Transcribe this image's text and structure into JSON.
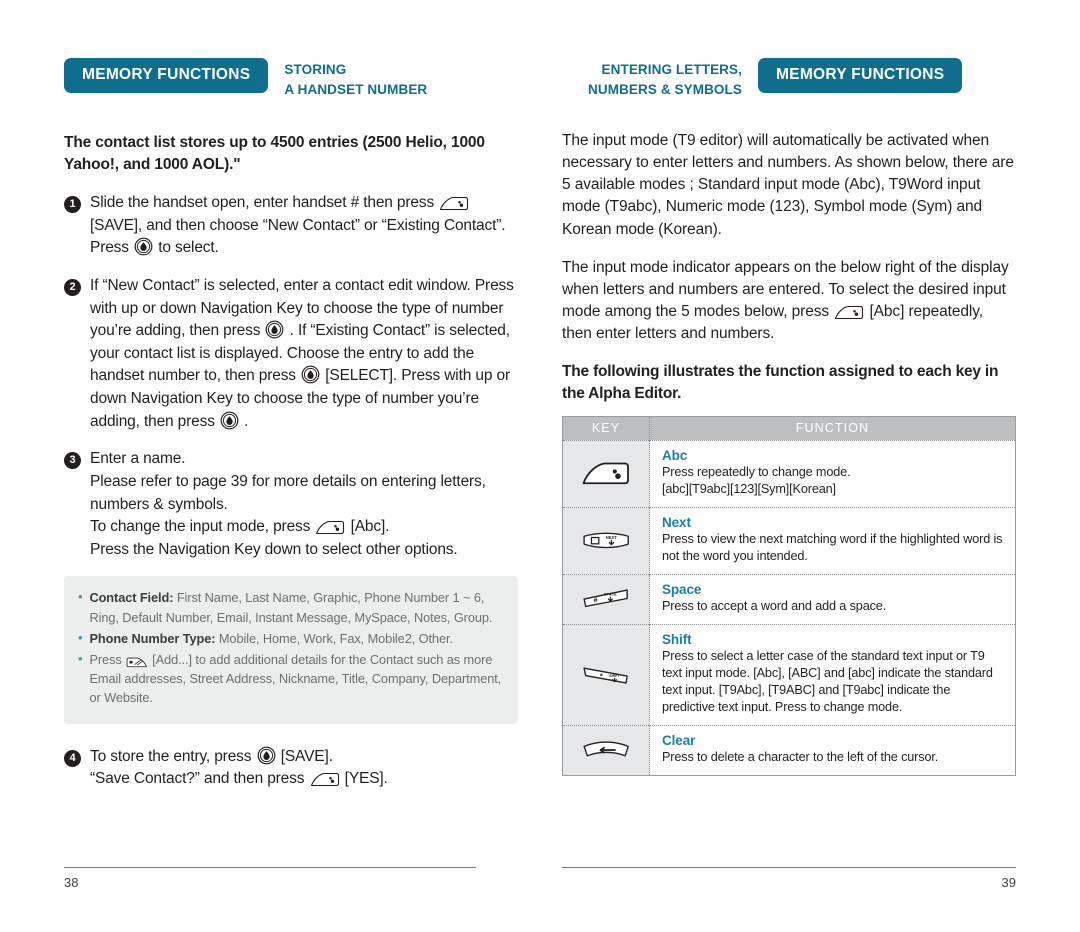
{
  "colors": {
    "brand_teal": "#0f6e8c",
    "heading_blue": "#1b7fa0",
    "note_grey_bg": "#eceded",
    "table_header_grey": "#bcbec0",
    "rule_blue": "#3f8fa3"
  },
  "left_page": {
    "chapter_tab": "MEMORY FUNCTIONS",
    "section_title": "STORING\nA HANDSET NUMBER",
    "lead": "The contact list stores up to 4500 entries (2500 Helio, 1000 Yahoo!, and 1000 AOL).\"",
    "steps": [
      {
        "num": "1",
        "parts": [
          {
            "t": "text",
            "v": "Slide the handset open, enter handset # then press "
          },
          {
            "t": "icon",
            "v": "left-softkey-icon"
          },
          {
            "t": "text",
            "v": " [SAVE], and then choose “New Contact” or “Existing Contact”. Press "
          },
          {
            "t": "icon",
            "v": "ok-select-key-icon"
          },
          {
            "t": "text",
            "v": " to select."
          }
        ]
      },
      {
        "num": "2",
        "parts": [
          {
            "t": "text",
            "v": "If “New Contact” is selected, enter a contact edit window. Press with up or down Navigation Key to choose the type of number you’re adding, then press "
          },
          {
            "t": "icon",
            "v": "ok-select-key-icon"
          },
          {
            "t": "text",
            "v": " . If “Existing Contact” is selected, your contact list is displayed. Choose the entry to add the handset number to, then press "
          },
          {
            "t": "icon",
            "v": "ok-select-key-icon"
          },
          {
            "t": "text",
            "v": " [SELECT]. Press with up or down Navigation Key to choose the type of number you’re adding, then press "
          },
          {
            "t": "icon",
            "v": "ok-select-key-icon"
          },
          {
            "t": "text",
            "v": " ."
          }
        ]
      },
      {
        "num": "3",
        "parts": [
          {
            "t": "text",
            "v": "Enter a name.\nPlease refer to page 39 for more details on entering letters, numbers & symbols.\nTo change the input mode, press "
          },
          {
            "t": "icon",
            "v": "left-softkey-icon"
          },
          {
            "t": "text",
            "v": " [Abc].\nPress the Navigation Key down to select other options."
          }
        ]
      }
    ],
    "note_box": [
      {
        "label": "Contact Field:",
        "text": " First Name, Last Name, Graphic, Phone Number 1 ~ 6, Ring, Default Number, Email, Instant Message, MySpace, Notes, Group."
      },
      {
        "label": "Phone Number Type:",
        "text": " Mobile, Home, Work, Fax, Mobile2, Other."
      },
      {
        "label": "",
        "pre": "Press ",
        "icon": "right-softkey-icon",
        "text": " [Add...] to add additional details for the Contact such as more Email addresses, Street Address, Nickname, Title, Company, Department, or Website."
      }
    ],
    "step4": {
      "num": "4",
      "parts": [
        {
          "t": "text",
          "v": "To store the entry, press "
        },
        {
          "t": "icon",
          "v": "ok-select-key-icon"
        },
        {
          "t": "text",
          "v": " [SAVE].\n“Save Contact?” and then press "
        },
        {
          "t": "icon",
          "v": "left-softkey-icon"
        },
        {
          "t": "text",
          "v": " [YES]."
        }
      ]
    },
    "page_number": "38"
  },
  "right_page": {
    "chapter_tab": "MEMORY FUNCTIONS",
    "section_title": "ENTERING LETTERS,\nNUMBERS & SYMBOLS",
    "paragraph_1": "The input mode (T9 editor) will automatically be activated when necessary to enter letters and numbers. As shown below, there are 5 available modes ; Standard input mode (Abc), T9Word input mode (T9abc), Numeric mode (123), Symbol mode (Sym) and Korean mode (Korean).",
    "paragraph_2_parts": [
      {
        "t": "text",
        "v": "The input mode indicator appears on the below right of the display when letters and numbers are entered. To select the desired input mode among the 5 modes below, press "
      },
      {
        "t": "icon",
        "v": "left-softkey-icon"
      },
      {
        "t": "text",
        "v": " [Abc] repeatedly, then enter letters and numbers."
      }
    ],
    "sub_lead": "The following illustrates the function assigned to each key in the Alpha Editor.",
    "table": {
      "headers": [
        "KEY",
        "FUNCTION"
      ],
      "rows": [
        {
          "key_icon": "left-softkey-icon",
          "title": "Abc",
          "desc": "Press repeatedly to change mode.\n[abc][T9abc][123][Sym][Korean]"
        },
        {
          "key_icon": "next-key-icon",
          "title": "Next",
          "desc": "Press to view the next matching word if the highlighted word is not the word you intended."
        },
        {
          "key_icon": "space-key-icon",
          "title": "Space",
          "desc": "Press to accept a word and add a space."
        },
        {
          "key_icon": "shift-key-icon",
          "title": "Shift",
          "desc": "Press to select a letter case of the standard text input or T9 text input mode. [Abc], [ABC] and [abc] indicate the standard text input. [T9Abc], [T9ABC] and [T9abc] indicate the predictive text input. Press to change mode."
        },
        {
          "key_icon": "clear-key-icon",
          "title": "Clear",
          "desc": "Press to delete a character to the left of the cursor."
        }
      ]
    },
    "page_number": "39"
  }
}
